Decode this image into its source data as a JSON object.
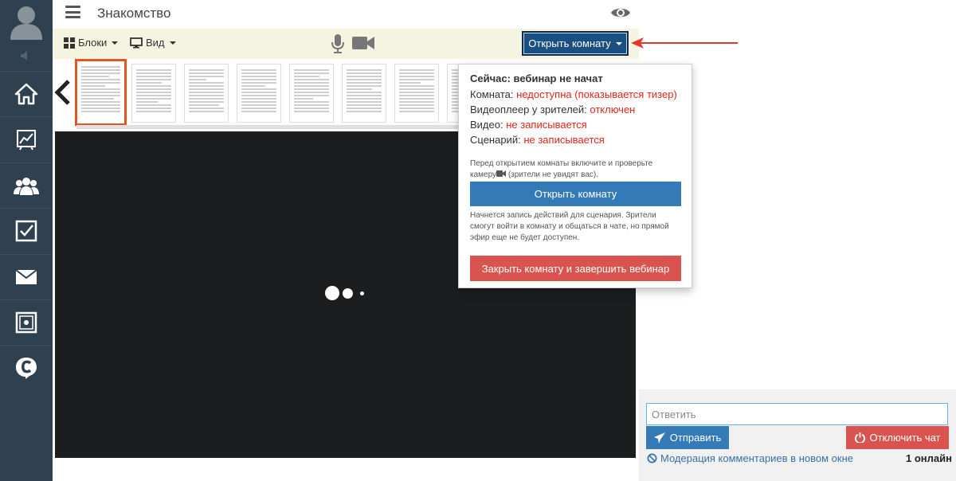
{
  "header": {
    "title": "Знакомство"
  },
  "toolbar": {
    "blocks_label": "Блоки",
    "view_label": "Вид",
    "open_room_label": "Открыть комнату"
  },
  "popup": {
    "status": "Сейчас: вебинар не начат",
    "room_label": "Комната:",
    "room_value": "недоступна (показывается тизер)",
    "player_label": "Видеоплеер у зрителей:",
    "player_value": "отключен",
    "video_label": "Видео:",
    "video_value": "не записывается",
    "scenario_label": "Сценарий:",
    "scenario_value": "не записывается",
    "note_before_a": "Перед открытием комнаты включите и проверьте камеру",
    "note_before_b": "(зрители не увидят вас).",
    "open_button": "Открыть комнату",
    "note_after": "Начнется запись действий для сценария. Зрители смогут войти в комнату и общаться в чате, но прямой эфир еще не будет доступен.",
    "close_button": "Закрыть комнату и завершить вебинар"
  },
  "chat": {
    "reply_placeholder": "Ответить",
    "send_label": "Отправить",
    "chat_off_label": "Отключить чат",
    "moderation_label": "Модерация комментариев в новом окне",
    "online_label": "1 онлайн"
  },
  "colors": {
    "sidebar": "#2f4050",
    "toolbar_bg": "#f4f4e0",
    "primary": "#337ab7",
    "danger": "#d9534f",
    "status_red": "#e0241c",
    "video_bg": "#1c1d1f",
    "active_thumb": "#e25422"
  },
  "icons": {
    "sidebar": [
      "avatar-icon",
      "sound-icon",
      "home-icon",
      "chart-icon",
      "users-icon",
      "checkbox-icon",
      "mail-icon",
      "safe-icon",
      "chat-logo-icon"
    ],
    "toolbar": [
      "grid-icon",
      "monitor-icon",
      "microphone-icon",
      "camera-icon"
    ]
  }
}
